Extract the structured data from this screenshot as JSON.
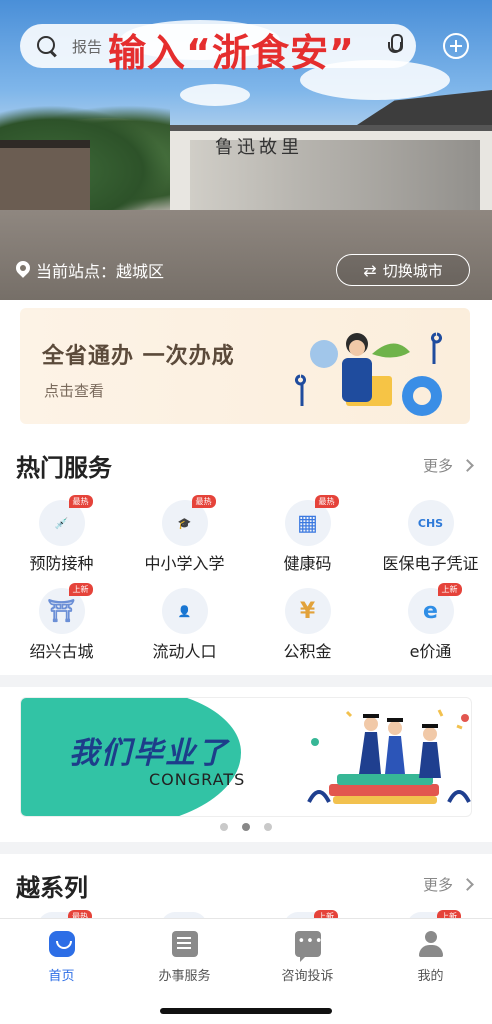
{
  "search": {
    "placeholder_visible": "报告",
    "overlay_hint": "输入“浙食安”"
  },
  "hero": {
    "wall_text": "鲁迅故里",
    "location_label": "当前站点：越城区",
    "switch_city": "切换城市"
  },
  "promo": {
    "title": "全省通办  一次办成",
    "subtitle": "点击查看"
  },
  "hot_services": {
    "title": "热门服务",
    "more": "更多",
    "items": [
      {
        "label": "预防接种",
        "badge": "最热",
        "icon": "syringe-icon",
        "glyph": "💉"
      },
      {
        "label": "中小学入学",
        "badge": "最热",
        "icon": "graduation-cap-icon",
        "glyph": "🎓"
      },
      {
        "label": "健康码",
        "badge": "最热",
        "icon": "qr-code-icon",
        "glyph": "▦"
      },
      {
        "label": "医保电子凭证",
        "badge": "",
        "icon": "chs-medical-insurance-icon",
        "glyph": "CHS"
      },
      {
        "label": "绍兴古城",
        "badge": "上新",
        "icon": "ancient-city-icon",
        "glyph": "⛩"
      },
      {
        "label": "流动人口",
        "badge": "",
        "icon": "id-card-icon",
        "glyph": "👤"
      },
      {
        "label": "公积金",
        "badge": "",
        "icon": "housing-fund-icon",
        "glyph": "¥"
      },
      {
        "label": "e价通",
        "badge": "上新",
        "icon": "e-price-icon",
        "glyph": "e"
      }
    ]
  },
  "banner": {
    "title": "我们毕业了",
    "subtitle": "CONGRATS",
    "pages": 3,
    "active_page": 2
  },
  "yue_series": {
    "title": "越系列",
    "more": "更多",
    "peek_badges": [
      "最热",
      "",
      "上新",
      "上新"
    ]
  },
  "tabbar": {
    "tabs": [
      {
        "label": "首页",
        "active": true
      },
      {
        "label": "办事服务",
        "active": false
      },
      {
        "label": "咨询投诉",
        "active": false
      },
      {
        "label": "我的",
        "active": false
      }
    ]
  },
  "colors": {
    "accent": "#2d6ee6",
    "overlay_red": "#e52e2e",
    "badge_red": "#e5433a",
    "banner_green": "#32c3a5"
  }
}
